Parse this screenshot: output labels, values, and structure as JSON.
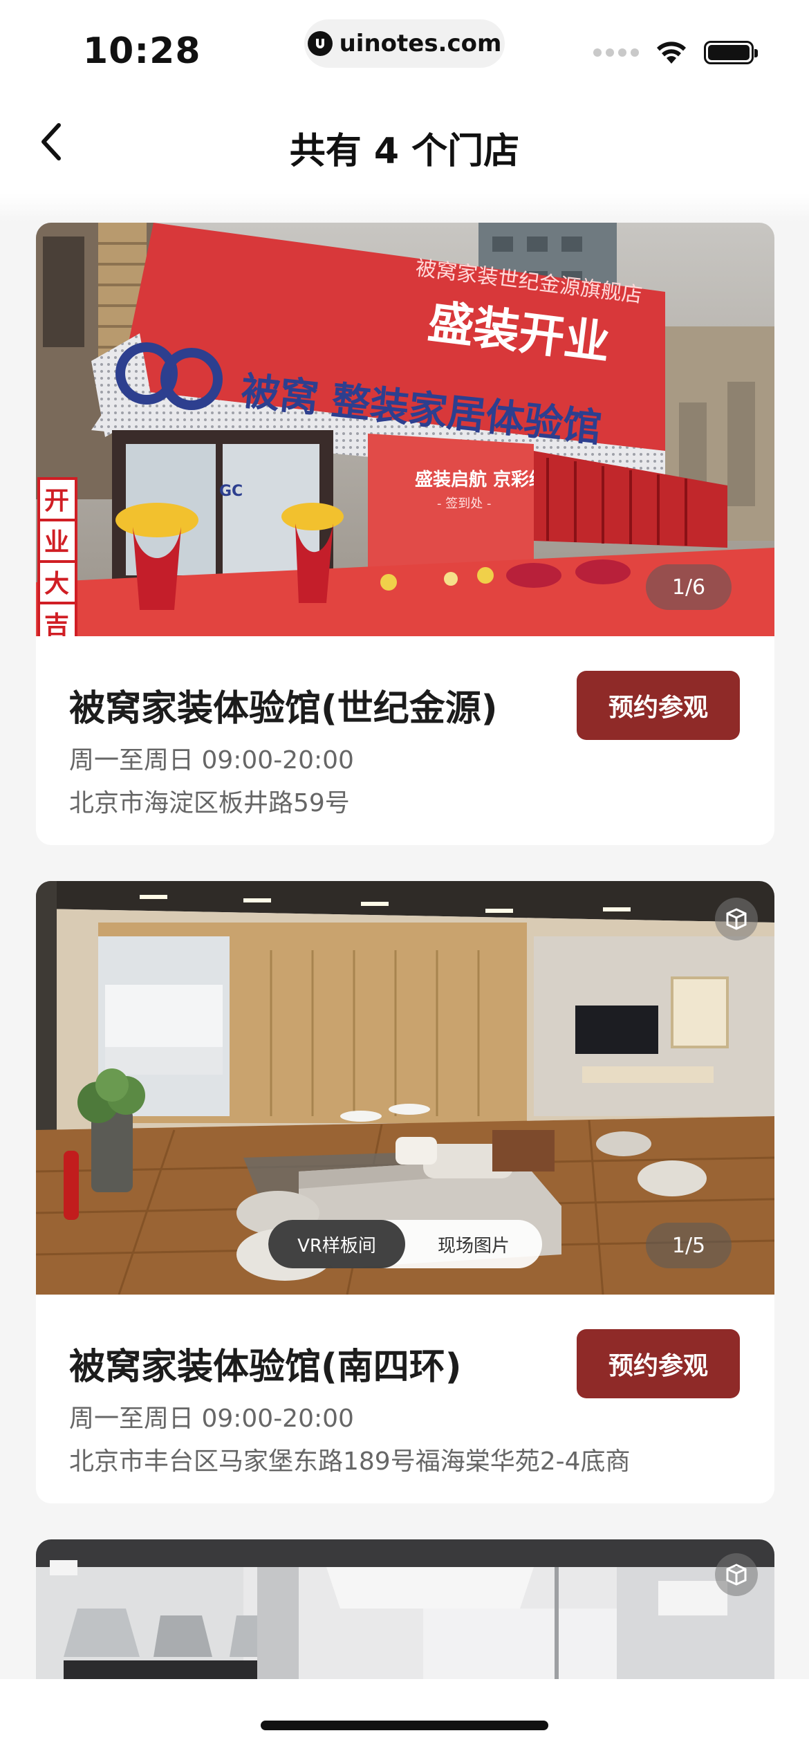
{
  "status_bar": {
    "time": "10:28",
    "url": "uinotes.com"
  },
  "header": {
    "title": "共有 4 个门店"
  },
  "stores": [
    {
      "name": "被窝家装体验馆(世纪金源)",
      "hours": "周一至周日 09:00-20:00",
      "address": "北京市海淀区板井路59号",
      "button_label": "预约参观",
      "image_counter": "1/6",
      "image_texts": {
        "banner_sub": "被窝家装世纪金源旗舰店",
        "banner_main": "盛装开业",
        "brand": "被窝 整装家居体验馆",
        "logo": "GC",
        "backdrop": "盛装启航 京彩绽放",
        "backdrop_sub": "- 签到处 -",
        "sign_chars": [
          "开",
          "业",
          "大",
          "吉"
        ]
      }
    },
    {
      "name": "被窝家装体验馆(南四环)",
      "hours": "周一至周日 09:00-20:00",
      "address": "北京市丰台区马家堡东路189号福海棠华苑2-4底商",
      "button_label": "预约参观",
      "image_counter": "1/5",
      "tabs": [
        {
          "label": "VR样板间",
          "active": true
        },
        {
          "label": "现场图片",
          "active": false
        }
      ]
    }
  ],
  "colors": {
    "accent": "#8f2a28",
    "background": "#f5f5f5",
    "card": "#ffffff",
    "secondary_text": "#666666"
  },
  "icons": [
    "back-chevron-icon",
    "wifi-icon",
    "battery-icon",
    "cube-3d-icon",
    "uinotes-logo-icon"
  ]
}
